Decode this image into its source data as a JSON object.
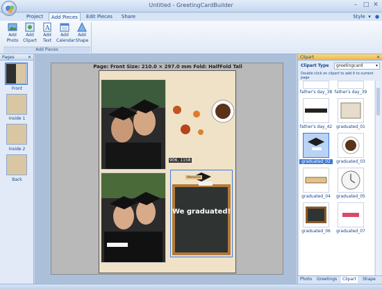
{
  "window": {
    "title": "Untitled - GreetingCardBuilder",
    "style_label": "Style"
  },
  "menu_tabs": [
    "Project",
    "Add Pieces",
    "Edit Pieces",
    "Share"
  ],
  "ribbon": {
    "group_label": "Add Pieces",
    "buttons": [
      {
        "l1": "Add",
        "l2": "Photo"
      },
      {
        "l1": "Add",
        "l2": "Clipart"
      },
      {
        "l1": "Add",
        "l2": "Text"
      },
      {
        "l1": "Add",
        "l2": "Calendar"
      },
      {
        "l1": "Add",
        "l2": "Shape"
      }
    ]
  },
  "pages_panel": {
    "title": "Pages",
    "items": [
      "Front",
      "Inside 1",
      "Inside 2",
      "Back"
    ]
  },
  "canvas": {
    "page_info": "Page: Front   Size: 210.0 × 297.0 mm    Fold: HalfFold Tall",
    "coords": "906, 1158",
    "card_text": "We graduated!",
    "memories_text": "Memories"
  },
  "clipart_panel": {
    "title": "Clipart",
    "type_label": "Clipart Type",
    "type_value": "greetingcard",
    "hint": "Double click on clipart to add it to current page",
    "items": [
      "father's day_38",
      "father's day_39",
      "father's day_42",
      "graduated_01",
      "graduated_02",
      "graduated_03",
      "graduated_04",
      "graduated_05",
      "graduated_06",
      "graduated_07"
    ],
    "bottom_tabs": [
      "Photo",
      "Greetings",
      "Clipart",
      "Shape"
    ]
  },
  "colors": {
    "accent": "#15428b",
    "selection": "#3b7ad9"
  }
}
